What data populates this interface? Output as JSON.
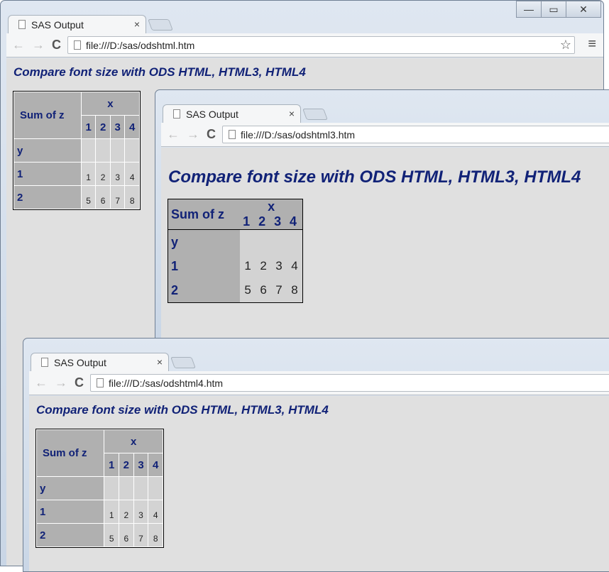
{
  "windows": [
    {
      "tab_title": "SAS Output",
      "close": "×",
      "url": "file:///D:/sas/odshtml.htm",
      "heading": "Compare font size with ODS HTML, HTML3, HTML4"
    },
    {
      "tab_title": "SAS Output",
      "close": "×",
      "url": "file:///D:/sas/odshtml3.htm",
      "heading": "Compare font size with ODS HTML, HTML3, HTML4"
    },
    {
      "tab_title": "SAS Output",
      "close": "×",
      "url": "file:///D:/sas/odshtml4.htm",
      "heading": "Compare font size with ODS HTML, HTML3, HTML4"
    }
  ],
  "window_controls": {
    "minimize": "—",
    "maximize": "▭",
    "close": "✕"
  },
  "nav": {
    "back": "←",
    "forward": "→",
    "reload": "C",
    "star": "☆",
    "menu": "≡"
  },
  "table": {
    "corner": "Sum of z",
    "col_var": "x",
    "cols": [
      "1",
      "2",
      "3",
      "4"
    ],
    "row_var": "y",
    "rows": [
      {
        "label": "1",
        "values": [
          "1",
          "2",
          "3",
          "4"
        ]
      },
      {
        "label": "2",
        "values": [
          "5",
          "6",
          "7",
          "8"
        ]
      }
    ]
  }
}
